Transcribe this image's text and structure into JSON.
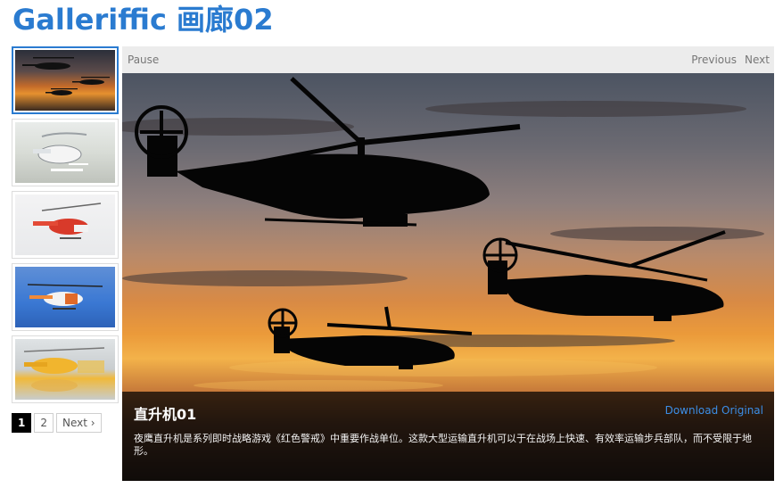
{
  "header": {
    "title": "Galleriffic 画廊02"
  },
  "controls": {
    "pause_label": "Pause",
    "previous_label": "Previous",
    "next_label": "Next"
  },
  "thumbnails": [
    {
      "subject": "helicopters-sunset",
      "selected": true
    },
    {
      "subject": "white-helicopter",
      "selected": false
    },
    {
      "subject": "red-white-helicopter",
      "selected": false
    },
    {
      "subject": "coast-guard-helicopter",
      "selected": false
    },
    {
      "subject": "yellow-helicopter-reflection",
      "selected": false
    }
  ],
  "pagination": {
    "pages": [
      "1",
      "2"
    ],
    "current": "1",
    "next_label": "Next ›"
  },
  "caption": {
    "title": "直升机01",
    "download_label": "Download Original",
    "description": "夜鹰直升机是系列即时战略游戏《红色警戒》中重要作战单位。这款大型运输直升机可以于在战场上快速、有效率运输步兵部队，而不受限于地形。"
  },
  "colors": {
    "accent": "#2a7bd0",
    "link": "#3c8ee6",
    "controls_bg": "#ececec",
    "caption_bg": "#000000"
  }
}
